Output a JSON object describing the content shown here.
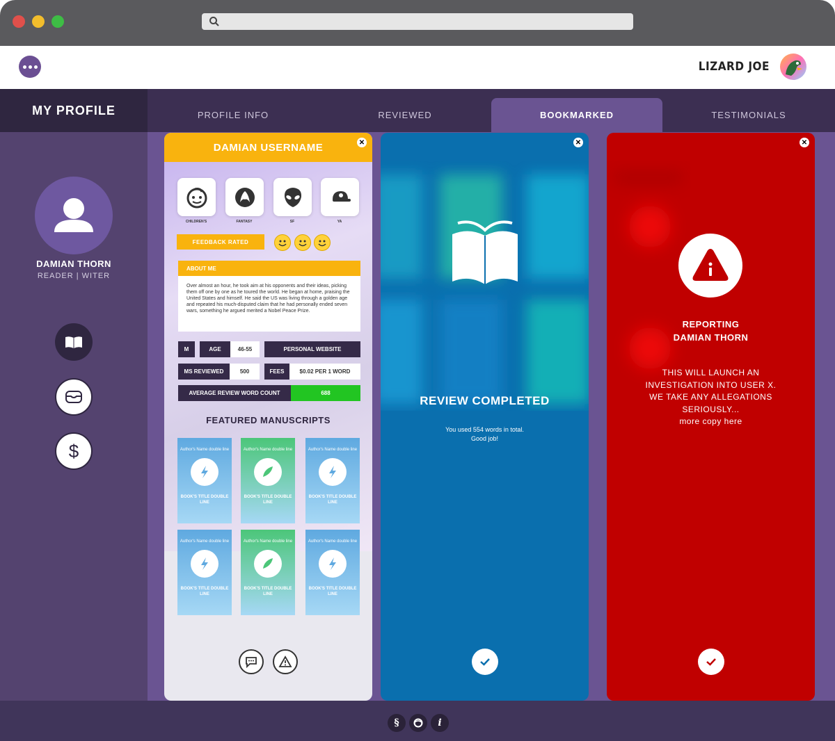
{
  "header": {
    "username": "LIZARD JOE"
  },
  "nav": {
    "my_profile": "MY PROFILE",
    "tabs": [
      {
        "label": "PROFILE INFO"
      },
      {
        "label": "REVIEWED"
      },
      {
        "label": "BOOKMARKED",
        "active": true
      },
      {
        "label": "TESTIMONIALS"
      }
    ]
  },
  "sidebar": {
    "name": "DAMIAN THORN",
    "role": "READER | WITER",
    "buttons": [
      {
        "icon": "book-icon"
      },
      {
        "icon": "inbox-icon"
      },
      {
        "icon": "dollar-icon"
      }
    ]
  },
  "profile_card": {
    "title": "DAMIAN USERNAME",
    "genres": [
      {
        "label": "CHILDREN'S",
        "icon": "child-face-icon"
      },
      {
        "label": "FANTASY",
        "icon": "dragon-icon"
      },
      {
        "label": "SF",
        "icon": "alien-icon"
      },
      {
        "label": "YA",
        "icon": "cap-icon"
      }
    ],
    "feedback_rated": "FEEDBACK RATED",
    "about_title": "ABOUT ME",
    "about_text": "Over almost an hour, he took aim at his opponents and their ideas, picking them off one by one as he toured the world. He began at home, praising the United States and himself. He said the US was living through a golden age and repeated his much-disputed claim that he had personally ended seven wars, something he argued merited a Nobel Peace Prize.",
    "gender": "M",
    "age_label": "AGE",
    "age_value": "46-55",
    "website_label": "PERSONAL WEBSITE",
    "ms_reviewed_label": "MS REVIEWED",
    "ms_reviewed_value": "500",
    "fees_label": "FEES",
    "fees_value": "$0.02 PER 1 WORD",
    "avg_label": "AVERAGE REVIEW WORD COUNT",
    "avg_value": "688",
    "featured_title": "FEATURED MANUSCRIPTS",
    "books": [
      {
        "author": "Author's Name double line",
        "title": "BOOK'S TITLE DOUBLE LINE",
        "color": "#5fa9e0",
        "icon": "lightning-icon"
      },
      {
        "author": "Author's Name double line",
        "title": "BOOK'S TITLE DOUBLE LINE",
        "color": "#4cc679",
        "icon": "feather-icon"
      },
      {
        "author": "Author's Name double line",
        "title": "BOOK'S TITLE DOUBLE LINE",
        "color": "#5fa9e0",
        "icon": "lightning-icon"
      },
      {
        "author": "Author's Name double line",
        "title": "BOOK'S TITLE DOUBLE LINE",
        "color": "#5fa9e0",
        "icon": "lightning-icon"
      },
      {
        "author": "Author's Name double line",
        "title": "BOOK'S TITLE DOUBLE LINE",
        "color": "#4cc679",
        "icon": "feather-icon"
      },
      {
        "author": "Author's Name double line",
        "title": "BOOK'S TITLE DOUBLE LINE",
        "color": "#5fa9e0",
        "icon": "lightning-icon"
      }
    ]
  },
  "review_card": {
    "title": "REVIEW COMPLETED",
    "line1": "You used 554 words in total.",
    "line2": "Good job!"
  },
  "report_card": {
    "title_line1": "REPORTING",
    "title_line2": "DAMIAN THORN",
    "body": [
      "THIS WILL LAUNCH AN",
      "INVESTIGATION INTO USER X.",
      "WE TAKE ANY ALLEGATIONS",
      "SERIOUSLY...",
      "more copy here"
    ]
  },
  "colors": {
    "accent": "#f9b30e",
    "purple": "#6a5492",
    "blue": "#0a6fae",
    "red": "#c00000",
    "green": "#22c522"
  }
}
